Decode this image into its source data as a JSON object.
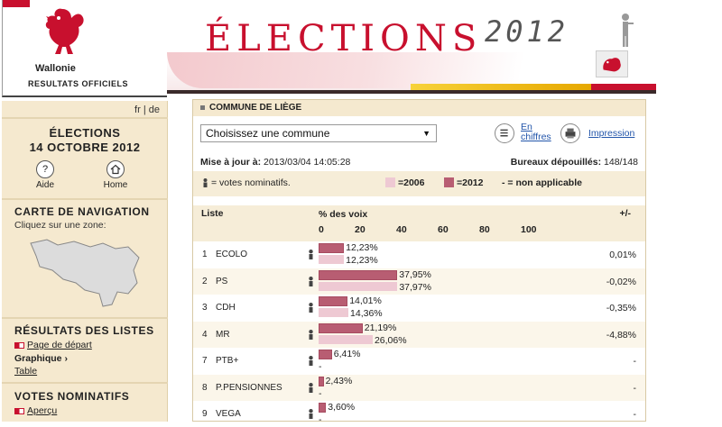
{
  "header": {
    "brand": "Wallonie",
    "subtitle": "RESULTATS OFFICIELS",
    "banner_title": "ÉLECTIONS",
    "banner_year": "2012"
  },
  "sidebar": {
    "lang_fr": "fr",
    "lang_sep": "|",
    "lang_de": "de",
    "election_line1": "ÉLECTIONS",
    "election_line2": "14 OCTOBRE 2012",
    "help_label": "Aide",
    "help_glyph": "?",
    "home_label": "Home",
    "nav_title": "CARTE DE NAVIGATION",
    "nav_subtitle": "Cliquez sur une zone:",
    "lists_title": "RÉSULTATS DES LISTES",
    "start_page": "Page de départ",
    "graph_label": "Graphique",
    "graph_arrow": "›",
    "table_link": "Table",
    "votes_title": "VOTES NOMINATIFS",
    "apercu_link": "Aperçu"
  },
  "main": {
    "commune_header": "COMMUNE DE LIÈGE",
    "select_value": "Choisissez une commune",
    "select_arrow": "▼",
    "figures_line1": "En",
    "figures_line2": "chiffres",
    "print_label": "Impression",
    "update_label": "Mise à jour à:",
    "update_value": "2013/03/04 14:05:28",
    "bureaux_label": "Bureaux dépouillés:",
    "bureaux_value": "148/148",
    "legend_nominative": "= votes nominatifs.",
    "legend_2006": "=2006",
    "legend_2012": "=2012",
    "legend_na": "- =  non applicable",
    "col_liste": "Liste",
    "col_pct": "% des voix",
    "col_diff": "+/-",
    "ticks": [
      "0",
      "20",
      "40",
      "60",
      "80",
      "100"
    ],
    "colors": {
      "y2012": "#b85d72",
      "y2006": "#eec9d3",
      "accent": "#c8102e"
    },
    "rows": [
      {
        "rank": "1",
        "party": "ECOLO",
        "v2012": 12.23,
        "v2006": 12.23,
        "l2012": "12,23%",
        "l2006": "12,23%",
        "diff": "0,01%"
      },
      {
        "rank": "2",
        "party": "PS",
        "v2012": 37.95,
        "v2006": 37.97,
        "l2012": "37,95%",
        "l2006": "37,97%",
        "diff": "-0,02%"
      },
      {
        "rank": "3",
        "party": "CDH",
        "v2012": 14.01,
        "v2006": 14.36,
        "l2012": "14,01%",
        "l2006": "14,36%",
        "diff": "-0,35%"
      },
      {
        "rank": "4",
        "party": "MR",
        "v2012": 21.19,
        "v2006": 26.06,
        "l2012": "21,19%",
        "l2006": "26,06%",
        "diff": "-4,88%"
      },
      {
        "rank": "7",
        "party": "PTB+",
        "v2012": 6.41,
        "v2006": null,
        "l2012": "6,41%",
        "l2006": "-",
        "diff": "-"
      },
      {
        "rank": "8",
        "party": "P.PENSIONNES",
        "v2012": 2.43,
        "v2006": null,
        "l2012": "2,43%",
        "l2006": "-",
        "diff": "-"
      },
      {
        "rank": "9",
        "party": "VEGA",
        "v2012": 3.6,
        "v2006": null,
        "l2012": "3,60%",
        "l2006": "-",
        "diff": "-"
      }
    ]
  }
}
